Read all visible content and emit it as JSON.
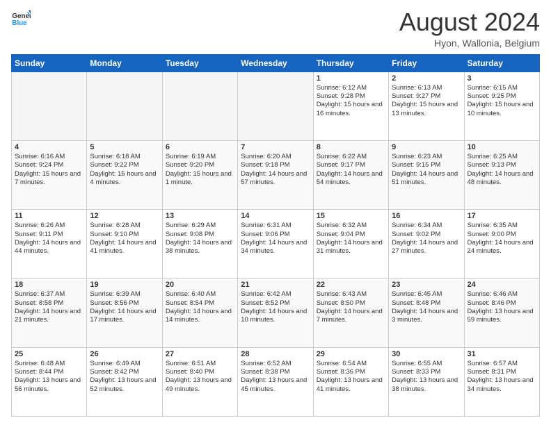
{
  "logo": {
    "line1": "General",
    "line2": "Blue"
  },
  "title": "August 2024",
  "subtitle": "Hyon, Wallonia, Belgium",
  "days": [
    "Sunday",
    "Monday",
    "Tuesday",
    "Wednesday",
    "Thursday",
    "Friday",
    "Saturday"
  ],
  "weeks": [
    [
      {
        "day": "",
        "content": ""
      },
      {
        "day": "",
        "content": ""
      },
      {
        "day": "",
        "content": ""
      },
      {
        "day": "",
        "content": ""
      },
      {
        "day": "1",
        "content": "Sunrise: 6:12 AM\nSunset: 9:28 PM\nDaylight: 15 hours and 16 minutes."
      },
      {
        "day": "2",
        "content": "Sunrise: 6:13 AM\nSunset: 9:27 PM\nDaylight: 15 hours and 13 minutes."
      },
      {
        "day": "3",
        "content": "Sunrise: 6:15 AM\nSunset: 9:25 PM\nDaylight: 15 hours and 10 minutes."
      }
    ],
    [
      {
        "day": "4",
        "content": "Sunrise: 6:16 AM\nSunset: 9:24 PM\nDaylight: 15 hours and 7 minutes."
      },
      {
        "day": "5",
        "content": "Sunrise: 6:18 AM\nSunset: 9:22 PM\nDaylight: 15 hours and 4 minutes."
      },
      {
        "day": "6",
        "content": "Sunrise: 6:19 AM\nSunset: 9:20 PM\nDaylight: 15 hours and 1 minute."
      },
      {
        "day": "7",
        "content": "Sunrise: 6:20 AM\nSunset: 9:18 PM\nDaylight: 14 hours and 57 minutes."
      },
      {
        "day": "8",
        "content": "Sunrise: 6:22 AM\nSunset: 9:17 PM\nDaylight: 14 hours and 54 minutes."
      },
      {
        "day": "9",
        "content": "Sunrise: 6:23 AM\nSunset: 9:15 PM\nDaylight: 14 hours and 51 minutes."
      },
      {
        "day": "10",
        "content": "Sunrise: 6:25 AM\nSunset: 9:13 PM\nDaylight: 14 hours and 48 minutes."
      }
    ],
    [
      {
        "day": "11",
        "content": "Sunrise: 6:26 AM\nSunset: 9:11 PM\nDaylight: 14 hours and 44 minutes."
      },
      {
        "day": "12",
        "content": "Sunrise: 6:28 AM\nSunset: 9:10 PM\nDaylight: 14 hours and 41 minutes."
      },
      {
        "day": "13",
        "content": "Sunrise: 6:29 AM\nSunset: 9:08 PM\nDaylight: 14 hours and 38 minutes."
      },
      {
        "day": "14",
        "content": "Sunrise: 6:31 AM\nSunset: 9:06 PM\nDaylight: 14 hours and 34 minutes."
      },
      {
        "day": "15",
        "content": "Sunrise: 6:32 AM\nSunset: 9:04 PM\nDaylight: 14 hours and 31 minutes."
      },
      {
        "day": "16",
        "content": "Sunrise: 6:34 AM\nSunset: 9:02 PM\nDaylight: 14 hours and 27 minutes."
      },
      {
        "day": "17",
        "content": "Sunrise: 6:35 AM\nSunset: 9:00 PM\nDaylight: 14 hours and 24 minutes."
      }
    ],
    [
      {
        "day": "18",
        "content": "Sunrise: 6:37 AM\nSunset: 8:58 PM\nDaylight: 14 hours and 21 minutes."
      },
      {
        "day": "19",
        "content": "Sunrise: 6:39 AM\nSunset: 8:56 PM\nDaylight: 14 hours and 17 minutes."
      },
      {
        "day": "20",
        "content": "Sunrise: 6:40 AM\nSunset: 8:54 PM\nDaylight: 14 hours and 14 minutes."
      },
      {
        "day": "21",
        "content": "Sunrise: 6:42 AM\nSunset: 8:52 PM\nDaylight: 14 hours and 10 minutes."
      },
      {
        "day": "22",
        "content": "Sunrise: 6:43 AM\nSunset: 8:50 PM\nDaylight: 14 hours and 7 minutes."
      },
      {
        "day": "23",
        "content": "Sunrise: 6:45 AM\nSunset: 8:48 PM\nDaylight: 14 hours and 3 minutes."
      },
      {
        "day": "24",
        "content": "Sunrise: 6:46 AM\nSunset: 8:46 PM\nDaylight: 13 hours and 59 minutes."
      }
    ],
    [
      {
        "day": "25",
        "content": "Sunrise: 6:48 AM\nSunset: 8:44 PM\nDaylight: 13 hours and 56 minutes."
      },
      {
        "day": "26",
        "content": "Sunrise: 6:49 AM\nSunset: 8:42 PM\nDaylight: 13 hours and 52 minutes."
      },
      {
        "day": "27",
        "content": "Sunrise: 6:51 AM\nSunset: 8:40 PM\nDaylight: 13 hours and 49 minutes."
      },
      {
        "day": "28",
        "content": "Sunrise: 6:52 AM\nSunset: 8:38 PM\nDaylight: 13 hours and 45 minutes."
      },
      {
        "day": "29",
        "content": "Sunrise: 6:54 AM\nSunset: 8:36 PM\nDaylight: 13 hours and 41 minutes."
      },
      {
        "day": "30",
        "content": "Sunrise: 6:55 AM\nSunset: 8:33 PM\nDaylight: 13 hours and 38 minutes."
      },
      {
        "day": "31",
        "content": "Sunrise: 6:57 AM\nSunset: 8:31 PM\nDaylight: 13 hours and 34 minutes."
      }
    ]
  ]
}
